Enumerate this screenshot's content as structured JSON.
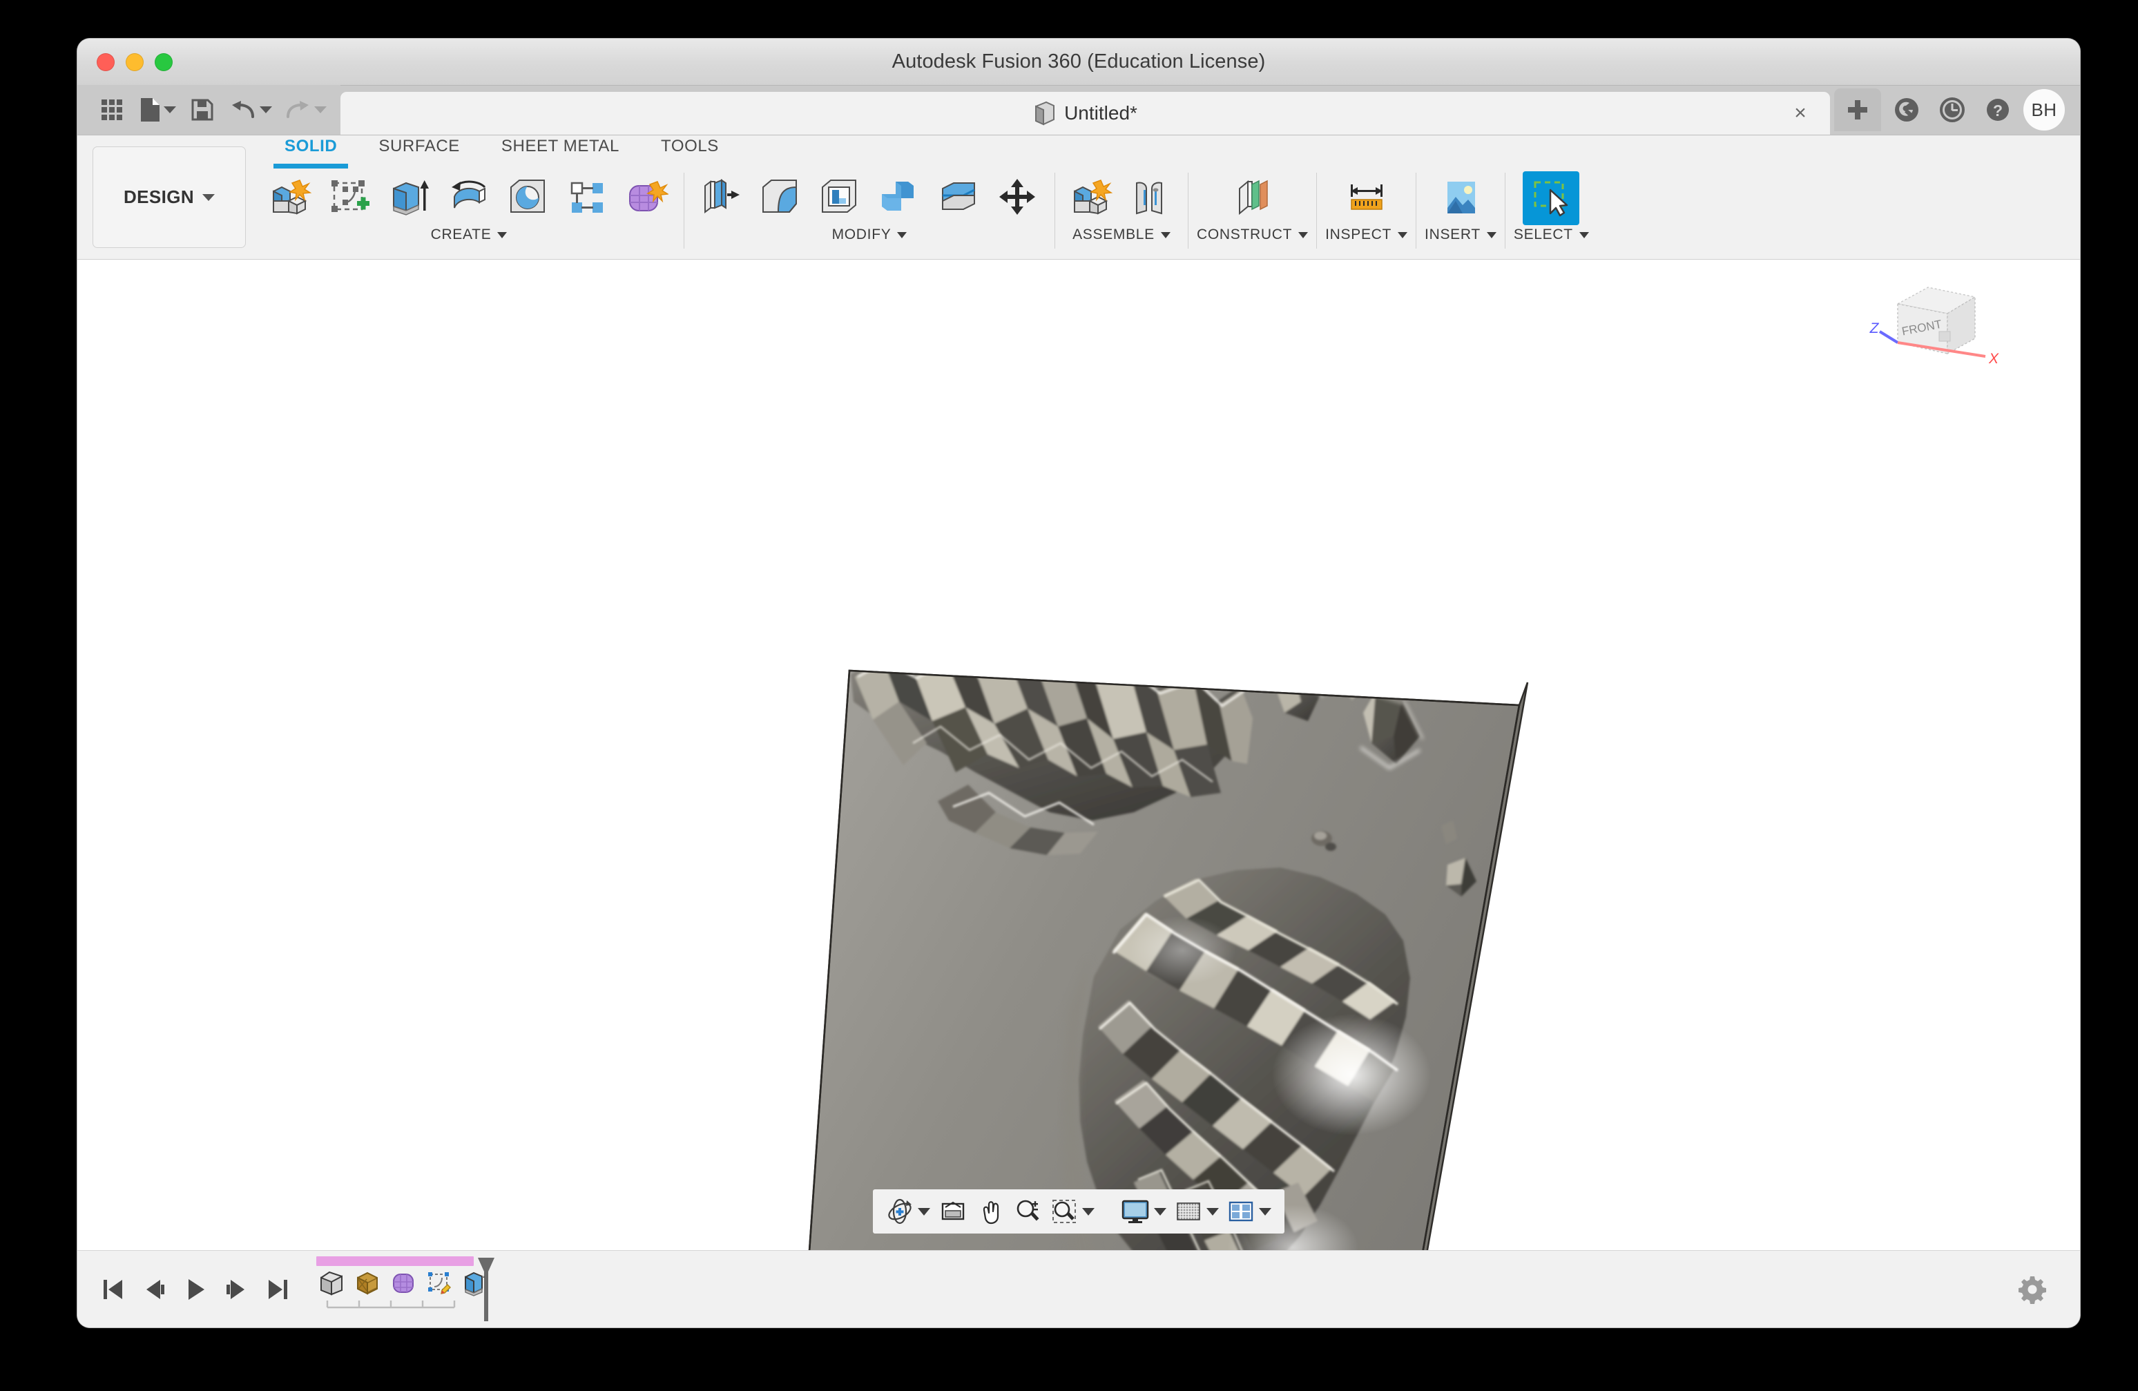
{
  "window": {
    "title": "Autodesk Fusion 360 (Education License)",
    "traffic_lights": [
      "close",
      "minimize",
      "zoom"
    ],
    "chrome_color": "#d9d9d9",
    "canvas_color": "#ffffff"
  },
  "quick_access": {
    "items": [
      {
        "name": "show-data-panel",
        "icon": "grid-icon",
        "label": "Show Data Panel"
      },
      {
        "name": "file",
        "icon": "file-icon",
        "label": "File",
        "has_caret": true
      },
      {
        "name": "save",
        "icon": "save-icon",
        "label": "Save"
      },
      {
        "name": "undo",
        "icon": "undo-icon",
        "label": "Undo",
        "has_caret": true
      },
      {
        "name": "redo",
        "icon": "redo-icon",
        "label": "Redo",
        "has_caret": true,
        "disabled": true
      }
    ]
  },
  "tabs": {
    "document": {
      "label": "Untitled*",
      "icon": "document-cube-icon",
      "close_label": "×",
      "active": true
    },
    "new_tab_label": "+",
    "right_icons": [
      {
        "name": "job-status-icon",
        "label": "Job Status"
      },
      {
        "name": "recent-activity-clock-icon",
        "label": "Recent"
      },
      {
        "name": "help-icon",
        "label": "Help"
      }
    ],
    "avatar": {
      "initials": "BH",
      "color": "#fbfbfb"
    }
  },
  "workspace": {
    "selector_label": "DESIGN",
    "accent_color": "#0696d7"
  },
  "ribbon": {
    "tabs": [
      {
        "label": "SOLID",
        "active": true
      },
      {
        "label": "SURFACE",
        "active": false
      },
      {
        "label": "SHEET METAL",
        "active": false
      },
      {
        "label": "TOOLS",
        "active": false
      }
    ],
    "groups": [
      {
        "label": "CREATE",
        "has_caret": true,
        "tools": [
          {
            "name": "new-component-icon",
            "label": "New Component"
          },
          {
            "name": "create-sketch-icon",
            "label": "Create Sketch"
          },
          {
            "name": "extrude-icon",
            "label": "Extrude"
          },
          {
            "name": "revolve-icon",
            "label": "Revolve"
          },
          {
            "name": "hole-icon",
            "label": "Hole"
          },
          {
            "name": "rectangular-pattern-icon",
            "label": "Rectangular Pattern"
          },
          {
            "name": "create-form-icon",
            "label": "Create Form"
          }
        ]
      },
      {
        "label": "MODIFY",
        "has_caret": true,
        "tools": [
          {
            "name": "press-pull-icon",
            "label": "Press Pull"
          },
          {
            "name": "fillet-icon",
            "label": "Fillet"
          },
          {
            "name": "shell-icon",
            "label": "Shell"
          },
          {
            "name": "combine-icon",
            "label": "Combine"
          },
          {
            "name": "split-face-icon",
            "label": "Split Face"
          },
          {
            "name": "move-copy-icon",
            "label": "Move/Copy"
          }
        ]
      },
      {
        "label": "ASSEMBLE",
        "has_caret": true,
        "tools": [
          {
            "name": "new-component-assemble-icon",
            "label": "New Component"
          },
          {
            "name": "joint-icon",
            "label": "Joint"
          }
        ]
      },
      {
        "label": "CONSTRUCT",
        "has_caret": true,
        "tools": [
          {
            "name": "offset-plane-icon",
            "label": "Offset Plane"
          }
        ]
      },
      {
        "label": "INSPECT",
        "has_caret": true,
        "tools": [
          {
            "name": "measure-icon",
            "label": "Measure"
          }
        ]
      },
      {
        "label": "INSERT",
        "has_caret": true,
        "tools": [
          {
            "name": "insert-image-icon",
            "label": "Insert Image"
          }
        ]
      },
      {
        "label": "SELECT",
        "has_caret": true,
        "tools": [
          {
            "name": "select-icon",
            "label": "Select",
            "selected": true
          }
        ]
      }
    ]
  },
  "viewcube": {
    "face_label": "FRONT",
    "axes": [
      {
        "label": "Z",
        "color": "#4a4aff"
      },
      {
        "label": "X",
        "color": "#ff4a4a"
      }
    ]
  },
  "model": {
    "name": "terrain-relief-plate",
    "description": "Tilted rectangular plate with sculpted mountain-range relief across its face",
    "base_color": "#8f8d88",
    "edge_color": "#3a3a3a"
  },
  "navbar": {
    "items": [
      {
        "name": "orbit-icon",
        "label": "Orbit",
        "has_caret": true
      },
      {
        "name": "look-at-icon",
        "label": "Look At",
        "has_caret": false
      },
      {
        "name": "pan-icon",
        "label": "Pan",
        "has_caret": false
      },
      {
        "name": "zoom-icon",
        "label": "Zoom",
        "has_caret": false
      },
      {
        "name": "zoom-window-icon",
        "label": "Zoom Window",
        "has_caret": true
      },
      {
        "name": "display-settings-icon",
        "label": "Display Settings",
        "has_caret": true
      },
      {
        "name": "grid-snaps-icon",
        "label": "Grid and Snaps",
        "has_caret": true
      },
      {
        "name": "viewports-icon",
        "label": "Viewports",
        "has_caret": true
      }
    ]
  },
  "timeline": {
    "playback": [
      {
        "name": "go-to-beginning-icon",
        "label": "Go to Beginning"
      },
      {
        "name": "step-back-icon",
        "label": "Step Back"
      },
      {
        "name": "play-icon",
        "label": "Play"
      },
      {
        "name": "step-forward-icon",
        "label": "Step Forward"
      },
      {
        "name": "go-to-end-icon",
        "label": "Go to End"
      }
    ],
    "group_bar_color": "#e8a0e4",
    "features": [
      {
        "name": "timeline-feature-patch",
        "icon": "patch-surface-icon",
        "label": "Patch"
      },
      {
        "name": "timeline-feature-box",
        "icon": "box-crate-icon",
        "label": "Box"
      },
      {
        "name": "timeline-feature-form",
        "icon": "form-mesh-icon",
        "label": "Create Form"
      },
      {
        "name": "timeline-feature-sketch",
        "icon": "sketch-edit-icon",
        "label": "Sketch"
      },
      {
        "name": "timeline-feature-extrude",
        "icon": "extrude-icon",
        "label": "Extrude"
      }
    ],
    "playhead_label": "Timeline Marker"
  },
  "settings": {
    "label": "Settings",
    "icon": "gear-icon"
  }
}
